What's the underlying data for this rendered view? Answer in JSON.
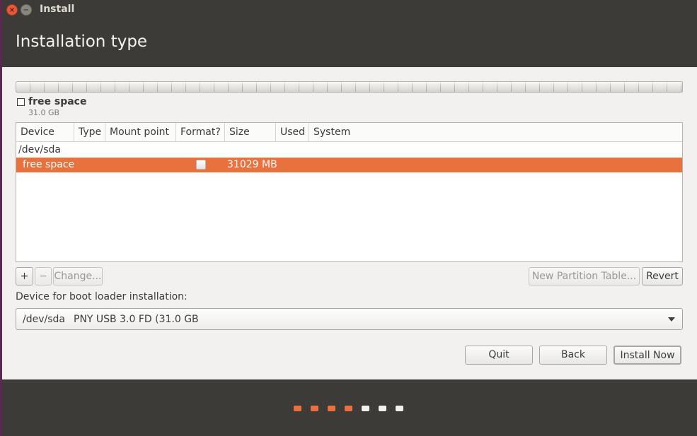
{
  "window": {
    "title": "Install"
  },
  "header": {
    "title": "Installation type"
  },
  "legend": {
    "label": "free space",
    "size": "31.0 GB"
  },
  "table": {
    "columns": [
      "Device",
      "Type",
      "Mount point",
      "Format?",
      "Size",
      "Used",
      "System"
    ],
    "device_row": "/dev/sda",
    "selected_row": {
      "device": "free space",
      "size": "31029 MB",
      "format_checked": false
    }
  },
  "partition_buttons": {
    "add": "+",
    "remove": "−",
    "change": "Change...",
    "new_table": "New Partition Table...",
    "revert": "Revert"
  },
  "boot": {
    "label": "Device for boot loader installation:",
    "device": "/dev/sda",
    "name": "PNY USB 3.0 FD (31.0 GB"
  },
  "actions": {
    "quit": "Quit",
    "back": "Back",
    "install": "Install Now"
  },
  "progress": {
    "current_step": 4,
    "total_steps": 7
  },
  "colors": {
    "accent": "#e9713e",
    "header_bg": "#3c3b37",
    "dot_active": "#e9713e",
    "dot_inactive": "#f2f1f0"
  }
}
